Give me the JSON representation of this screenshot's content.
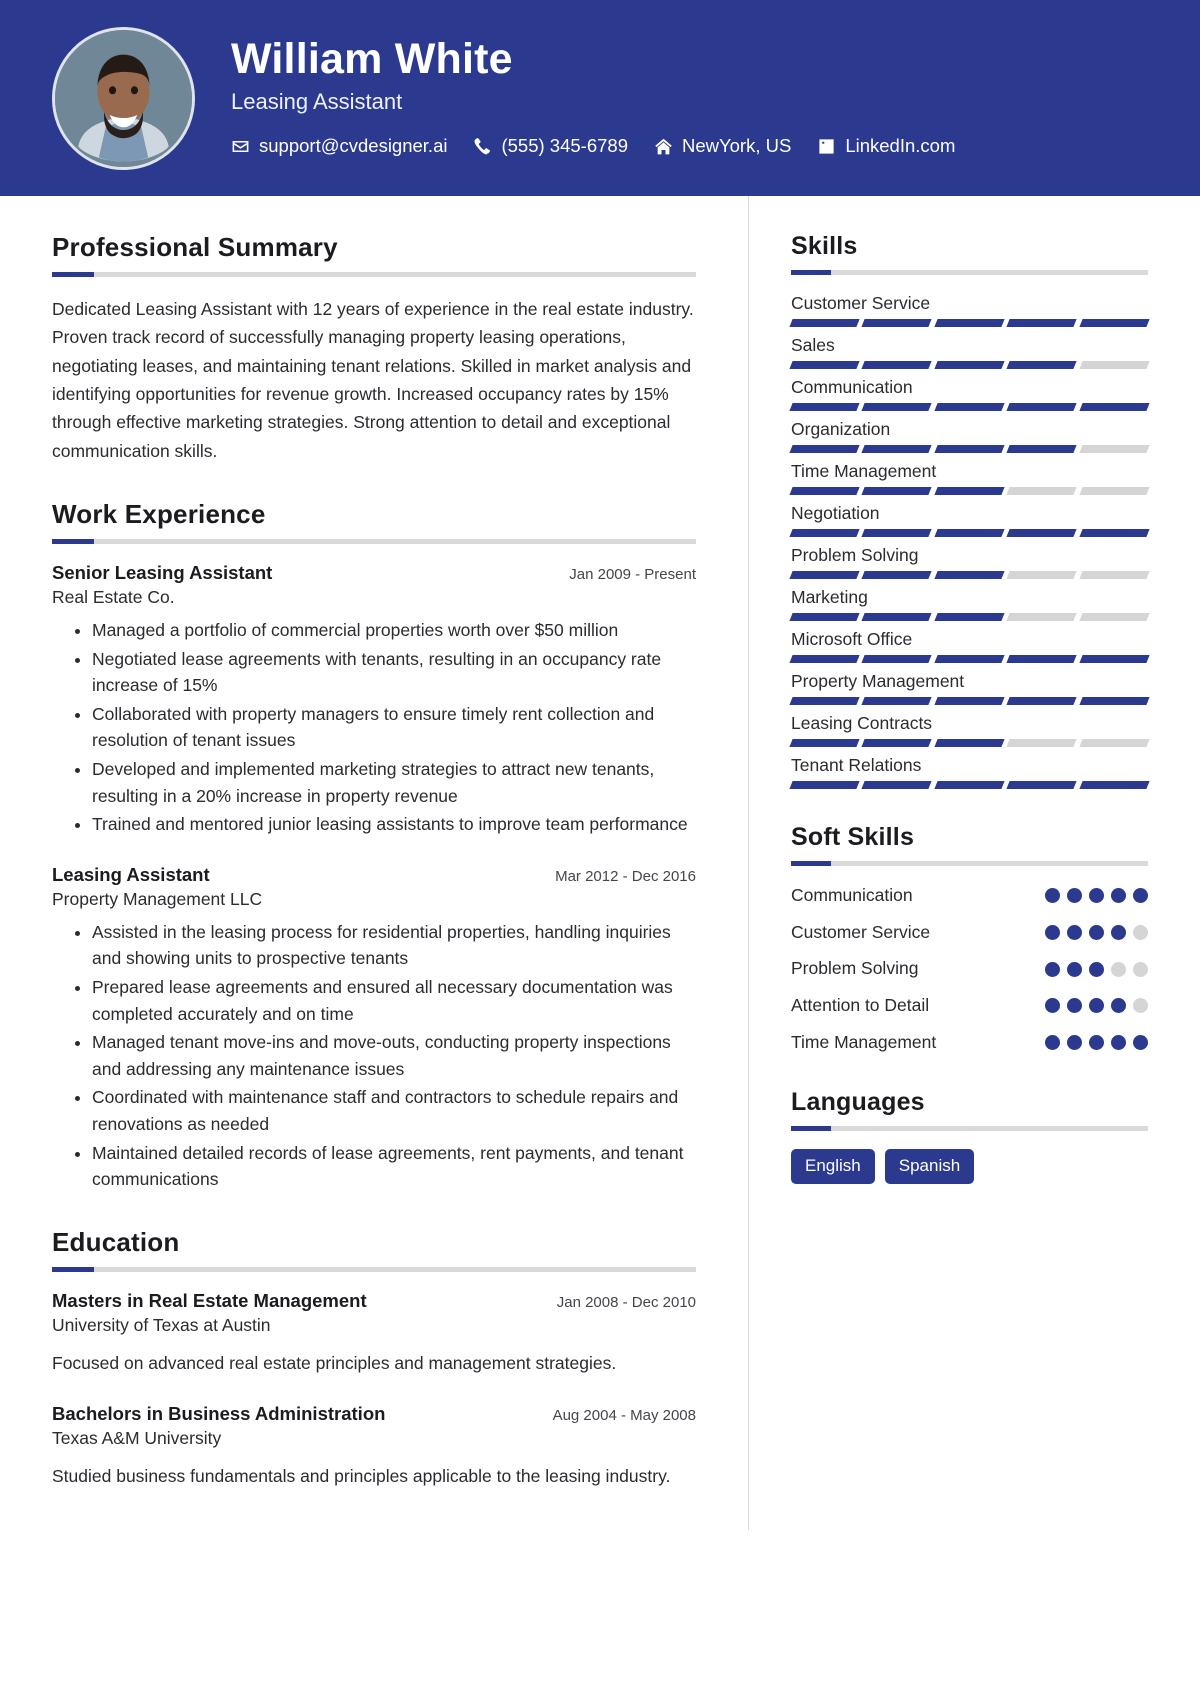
{
  "theme": {
    "accent": "#2b3a8f",
    "muted": "#d5d5d5",
    "header_bg": "#2b3a8f"
  },
  "header": {
    "name": "William White",
    "role": "Leasing Assistant",
    "avatar_icon": "profile-photo",
    "contacts": [
      {
        "icon": "envelope-icon",
        "label": "support@cvdesigner.ai"
      },
      {
        "icon": "phone-icon",
        "label": "(555) 345-6789"
      },
      {
        "icon": "home-icon",
        "label": "NewYork, US"
      },
      {
        "icon": "linkedin-icon",
        "label": "LinkedIn.com"
      }
    ]
  },
  "summary": {
    "title": "Professional Summary",
    "text": "Dedicated Leasing Assistant with 12 years of experience in the real estate industry. Proven track record of successfully managing property leasing operations, negotiating leases, and maintaining tenant relations. Skilled in market analysis and identifying opportunities for revenue growth. Increased occupancy rates by 15% through effective marketing strategies. Strong attention to detail and exceptional communication skills."
  },
  "experience": {
    "title": "Work Experience",
    "entries": [
      {
        "title": "Senior Leasing Assistant",
        "org": "Real Estate Co.",
        "date": "Jan 2009 - Present",
        "bullets": [
          "Managed a portfolio of commercial properties worth over $50 million",
          "Negotiated lease agreements with tenants, resulting in an occupancy rate increase of 15%",
          "Collaborated with property managers to ensure timely rent collection and resolution of tenant issues",
          "Developed and implemented marketing strategies to attract new tenants, resulting in a 20% increase in property revenue",
          "Trained and mentored junior leasing assistants to improve team performance"
        ]
      },
      {
        "title": "Leasing Assistant",
        "org": "Property Management LLC",
        "date": "Mar 2012 - Dec 2016",
        "bullets": [
          "Assisted in the leasing process for residential properties, handling inquiries and showing units to prospective tenants",
          "Prepared lease agreements and ensured all necessary documentation was completed accurately and on time",
          "Managed tenant move-ins and move-outs, conducting property inspections and addressing any maintenance issues",
          "Coordinated with maintenance staff and contractors to schedule repairs and renovations as needed",
          "Maintained detailed records of lease agreements, rent payments, and tenant communications"
        ]
      }
    ]
  },
  "education": {
    "title": "Education",
    "entries": [
      {
        "title": "Masters in Real Estate Management",
        "org": "University of Texas at Austin",
        "date": "Jan 2008 - Dec 2010",
        "desc": "Focused on advanced real estate principles and management strategies."
      },
      {
        "title": "Bachelors in Business Administration",
        "org": "Texas A&M University",
        "date": "Aug 2004 - May 2008",
        "desc": "Studied business fundamentals and principles applicable to the leasing industry."
      }
    ]
  },
  "skills": {
    "title": "Skills",
    "max": 5,
    "items": [
      {
        "label": "Customer Service",
        "level": 5
      },
      {
        "label": "Sales",
        "level": 4
      },
      {
        "label": "Communication",
        "level": 5
      },
      {
        "label": "Organization",
        "level": 4
      },
      {
        "label": "Time Management",
        "level": 3
      },
      {
        "label": "Negotiation",
        "level": 5
      },
      {
        "label": "Problem Solving",
        "level": 3
      },
      {
        "label": "Marketing",
        "level": 3
      },
      {
        "label": "Microsoft Office",
        "level": 5
      },
      {
        "label": "Property Management",
        "level": 5
      },
      {
        "label": "Leasing Contracts",
        "level": 3
      },
      {
        "label": "Tenant Relations",
        "level": 5
      }
    ]
  },
  "soft_skills": {
    "title": "Soft Skills",
    "max": 5,
    "items": [
      {
        "label": "Communication",
        "level": 5
      },
      {
        "label": "Customer Service",
        "level": 4
      },
      {
        "label": "Problem Solving",
        "level": 3
      },
      {
        "label": "Attention to Detail",
        "level": 4
      },
      {
        "label": "Time Management",
        "level": 5
      }
    ]
  },
  "languages": {
    "title": "Languages",
    "items": [
      "English",
      "Spanish"
    ]
  }
}
